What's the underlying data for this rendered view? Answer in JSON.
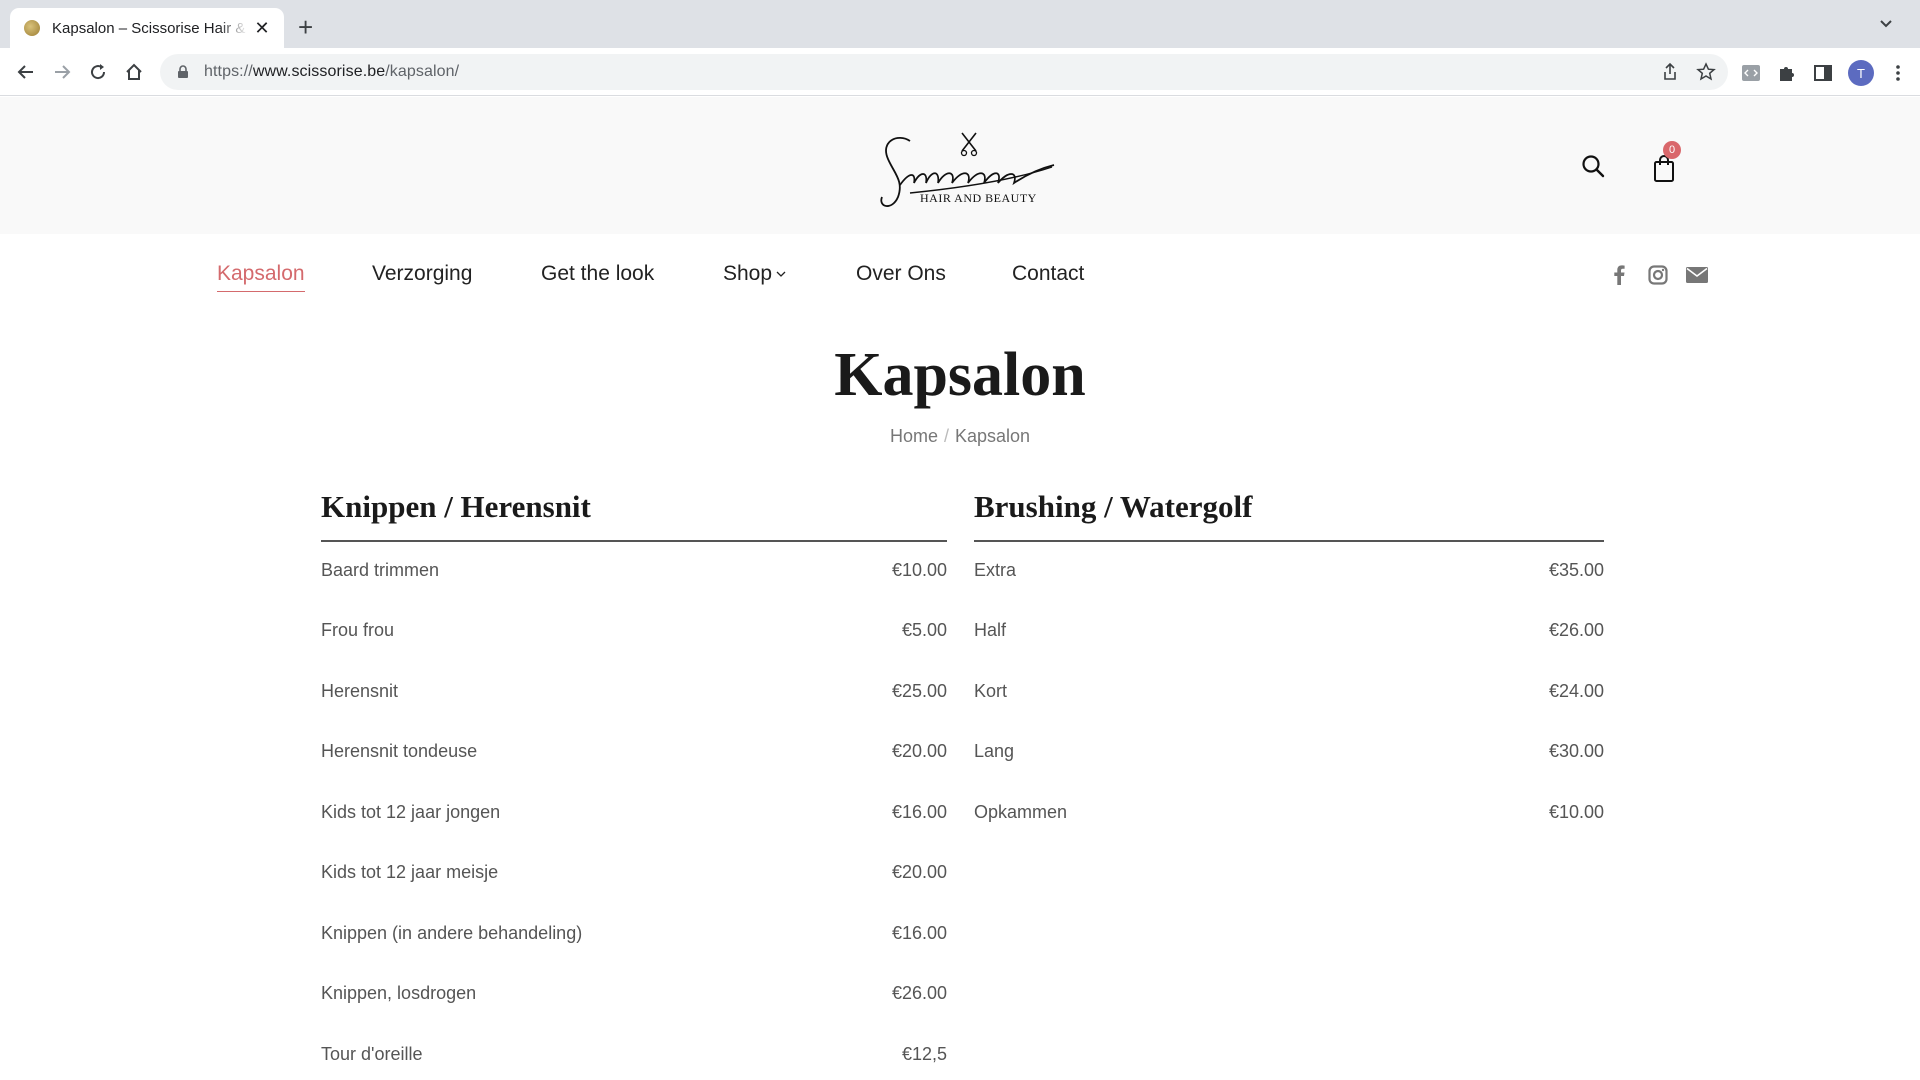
{
  "browser": {
    "tab_title": "Kapsalon – Scissorise Hair & Beauty",
    "tab_close": "✕",
    "new_tab": "+",
    "url_scheme": "https://",
    "url_host": "www.scissorise.be",
    "url_path": "/kapsalon/",
    "profile_initial": "T"
  },
  "header": {
    "logo_text": "Scissorise",
    "logo_subtitle": "HAIR AND BEAUTY",
    "cart_count": "0"
  },
  "nav": {
    "items": [
      {
        "label": "Kapsalon",
        "active": true
      },
      {
        "label": "Verzorging"
      },
      {
        "label": "Get the look"
      },
      {
        "label": "Shop"
      },
      {
        "label": "Over Ons"
      },
      {
        "label": "Contact"
      }
    ]
  },
  "page": {
    "title": "Kapsalon",
    "breadcrumb": {
      "home": "Home",
      "separator": "/",
      "current": "Kapsalon"
    }
  },
  "price_lists": [
    {
      "heading": "Knippen / Herensnit",
      "items": [
        {
          "name": "Baard trimmen",
          "price": "€10.00"
        },
        {
          "name": "Frou frou",
          "price": "€5.00"
        },
        {
          "name": "Herensnit",
          "price": "€25.00"
        },
        {
          "name": "Herensnit tondeuse",
          "price": "€20.00"
        },
        {
          "name": "Kids tot 12 jaar jongen",
          "price": "€16.00"
        },
        {
          "name": "Kids tot 12 jaar meisje",
          "price": "€20.00"
        },
        {
          "name": "Knippen (in andere behandeling)",
          "price": "€16.00"
        },
        {
          "name": "Knippen, losdrogen",
          "price": "€26.00"
        },
        {
          "name": "Tour d'oreille",
          "price": "€12,5"
        }
      ]
    },
    {
      "heading": "Brushing / Watergolf",
      "items": [
        {
          "name": "Extra",
          "price": "€35.00"
        },
        {
          "name": "Half",
          "price": "€26.00"
        },
        {
          "name": "Kort",
          "price": "€24.00"
        },
        {
          "name": "Lang",
          "price": "€30.00"
        },
        {
          "name": "Opkammen",
          "price": "€10.00"
        }
      ]
    }
  ],
  "colors": {
    "accent": "#d46a6d",
    "badge": "#d9676b",
    "header_bg": "#f9f9f9"
  }
}
